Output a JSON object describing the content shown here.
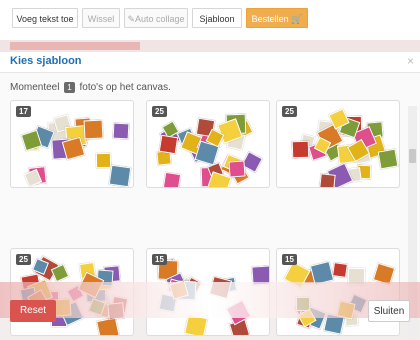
{
  "toolbar": {
    "add_text": "Voeg tekst toe",
    "swap": "Wissel",
    "auto_collage": "Auto collage",
    "template": "Sjabloon",
    "order": "Bestellen"
  },
  "modal": {
    "title": "Kies sjabloon",
    "info_before": "Momenteel",
    "info_count": "1",
    "info_after": "foto's op het canvas.",
    "reset": "Reset",
    "close": "Sluiten"
  },
  "templates": [
    {
      "count": "17"
    },
    {
      "count": "25"
    },
    {
      "count": "25"
    },
    {
      "count": "25"
    },
    {
      "count": "15"
    },
    {
      "count": "15"
    }
  ],
  "colors": {
    "accent": "#1f6fb2",
    "order": "#f0ad4e",
    "reset": "#d9534f"
  }
}
